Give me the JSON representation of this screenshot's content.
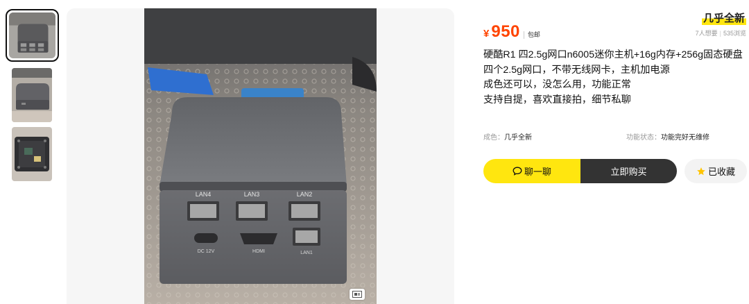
{
  "thumbnails": [
    {
      "name": "thumb-1",
      "active": true
    },
    {
      "name": "thumb-2",
      "active": false
    },
    {
      "name": "thumb-3",
      "active": false
    }
  ],
  "photo": {
    "port_labels_top": [
      "LAN4",
      "LAN3",
      "LAN2"
    ],
    "port_labels_bottom": [
      "DC 12V",
      "HDMI",
      "LAN1"
    ]
  },
  "condition_badge": "几乎全新",
  "price": {
    "currency": "¥",
    "amount": "950",
    "shipping": "包邮"
  },
  "stats": {
    "wants": "7人想要",
    "views": "535浏览"
  },
  "description": [
    "硬酷R1 四2.5g网口n6005迷你主机+16g内存+256g固态硬盘",
    "四个2.5g网口，不带无线网卡，主机加电源",
    "成色还可以，没怎么用，功能正常",
    "支持自提，喜欢直接拍，细节私聊"
  ],
  "attributes": [
    {
      "key": "成色：",
      "value": "几乎全新"
    },
    {
      "key": "功能状态：",
      "value": "功能完好无维修"
    }
  ],
  "actions": {
    "chat": "聊一聊",
    "buy": "立即购买",
    "favorite": "已收藏"
  },
  "colors": {
    "accent_yellow": "#ffe60f",
    "price_orange": "#ff4400",
    "dark_button": "#333333"
  }
}
